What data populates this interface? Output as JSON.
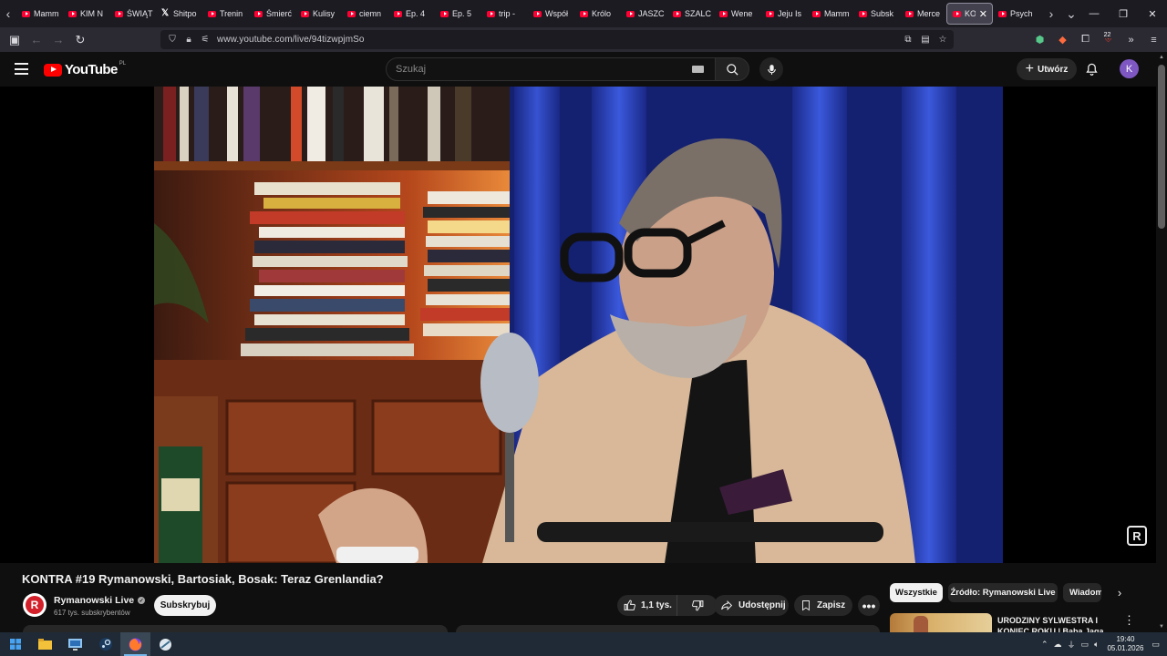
{
  "browser": {
    "tabs": [
      {
        "label": "Mamm",
        "icon": "youtube"
      },
      {
        "label": "KIM N",
        "icon": "youtube"
      },
      {
        "label": "ŚWIĄT",
        "icon": "youtube"
      },
      {
        "label": "Shitpo",
        "icon": "x"
      },
      {
        "label": "Trenin",
        "icon": "youtube"
      },
      {
        "label": "Śmierć",
        "icon": "youtube"
      },
      {
        "label": "Kulisy",
        "icon": "youtube"
      },
      {
        "label": "ciemn",
        "icon": "youtube"
      },
      {
        "label": "Ep. 4",
        "icon": "youtube"
      },
      {
        "label": "Ep. 5",
        "icon": "youtube"
      },
      {
        "label": "trip -",
        "icon": "youtube"
      },
      {
        "label": "Współ",
        "icon": "youtube"
      },
      {
        "label": "Królo",
        "icon": "youtube"
      },
      {
        "label": "JASZC",
        "icon": "youtube"
      },
      {
        "label": "SZALC",
        "icon": "youtube"
      },
      {
        "label": "Wene",
        "icon": "youtube"
      },
      {
        "label": "Jeju Is",
        "icon": "youtube"
      },
      {
        "label": "Mamm",
        "icon": "youtube"
      },
      {
        "label": "Subsk",
        "icon": "youtube"
      },
      {
        "label": "Merce",
        "icon": "youtube"
      },
      {
        "label": "KO",
        "icon": "youtube",
        "active": true
      },
      {
        "label": "Psych",
        "icon": "youtube"
      }
    ],
    "url": "www.youtube.com/live/94tizwpjmSo",
    "extension_badge": "22"
  },
  "youtube": {
    "logo_text": "YouTube",
    "country_code": "PL",
    "search_placeholder": "Szukaj",
    "create_label": "Utwórz",
    "avatar_letter": "K"
  },
  "video": {
    "title": "KONTRA #19 Rymanowski, Bartosiak, Bosak: Teraz Grenlandia?",
    "watermark": "R"
  },
  "channel": {
    "name": "Rymanowski Live",
    "avatar_letter": "R",
    "subscribers": "617 tys. subskrybentów",
    "subscribe_label": "Subskrybuj"
  },
  "actions": {
    "likes": "1,1 tys.",
    "share_label": "Udostępnij",
    "save_label": "Zapisz"
  },
  "chips": [
    "Wszystkie",
    "Źródło: Rymanowski Live",
    "Wiadom"
  ],
  "recommended": [
    {
      "title": "URODZINY SYLWESTRA I KONIEC ROKU | Baba Jaga"
    }
  ],
  "taskbar": {
    "time": "19:40",
    "date": "05.01.2026"
  }
}
